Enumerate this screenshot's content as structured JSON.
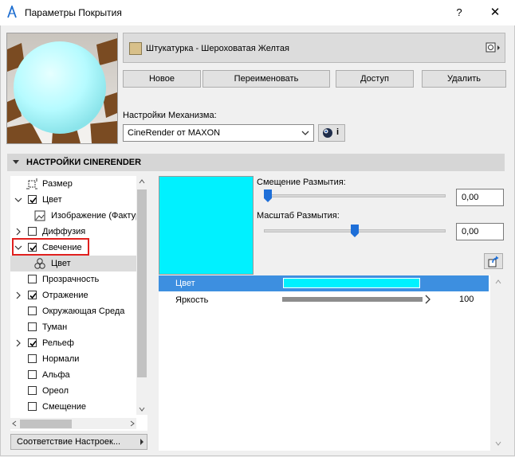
{
  "window": {
    "title": "Параметры Покрытия",
    "help_label": "?",
    "close_label": "✕"
  },
  "material": {
    "name": "Штукатурка - Шероховатая Желтая",
    "swatch_color": "#d8c08a"
  },
  "buttons": {
    "new": "Новое",
    "rename": "Переименовать",
    "access": "Доступ",
    "delete": "Удалить"
  },
  "engine": {
    "label": "Настройки Механизма:",
    "value": "CineRender от MAXON",
    "info_label": "i"
  },
  "section": {
    "title": "НАСТРОЙКИ CINERENDER"
  },
  "tree": {
    "items": [
      {
        "label": "Размер",
        "icon": "size-icon"
      },
      {
        "label": "Цвет",
        "checked": true,
        "expanded": true
      },
      {
        "label": "Изображение (Фактура)",
        "icon": "image-icon"
      },
      {
        "label": "Диффузия",
        "checked": false,
        "expanded": false
      },
      {
        "label": "Свечение",
        "checked": true,
        "expanded": true
      },
      {
        "label": "Цвет",
        "icon": "color-channel-icon",
        "selected": true
      },
      {
        "label": "Прозрачность",
        "checked": false
      },
      {
        "label": "Отражение",
        "checked": true,
        "expanded": false
      },
      {
        "label": "Окружающая Среда",
        "checked": false
      },
      {
        "label": "Туман",
        "checked": false
      },
      {
        "label": "Рельеф",
        "checked": true,
        "expanded": false
      },
      {
        "label": "Нормали",
        "checked": false
      },
      {
        "label": "Альфа",
        "checked": false
      },
      {
        "label": "Ореол",
        "checked": false
      },
      {
        "label": "Смещение",
        "checked": false
      }
    ],
    "match_button": "Соответствие Настроек..."
  },
  "right_panel": {
    "preview_color": "#00f1ff",
    "blur_offset": {
      "label": "Смещение Размытия:",
      "value": "0,00",
      "slider_fraction": 0.0
    },
    "blur_scale": {
      "label": "Масштаб Размытия:",
      "value": "0,00",
      "slider_fraction": 0.5
    },
    "properties": [
      {
        "name": "Цвет",
        "color": "#00f1ff"
      },
      {
        "name": "Яркость",
        "value": "100",
        "fraction": 1.0
      }
    ]
  }
}
